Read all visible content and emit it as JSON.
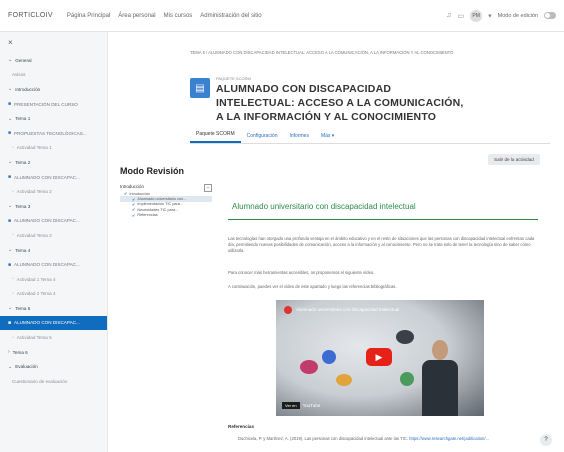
{
  "navbar": {
    "brand": "FORTICLOIV",
    "links": [
      "Página Principal",
      "Área personal",
      "Mis cursos",
      "Administración del sitio"
    ],
    "bell_icon": "bell-icon",
    "chat_icon": "chat-icon",
    "avatar": "PM",
    "edit_mode_label": "Modo de edición"
  },
  "sidebar": {
    "close": "×",
    "items": [
      {
        "label": "General",
        "kind": "section",
        "icon": "chevron-down-icon"
      },
      {
        "label": "Avisos",
        "kind": "sub",
        "icon": ""
      },
      {
        "label": "Introducción",
        "kind": "section",
        "icon": "chevron-down-icon"
      },
      {
        "label": "PRESENTACIÓN DEL CURSO",
        "kind": "activity",
        "icon": "scorm-icon"
      },
      {
        "label": "Tema 1",
        "kind": "section",
        "icon": "chevron-down-icon"
      },
      {
        "label": "PROPUESTAS TECNOLÓGICAS...",
        "kind": "activity",
        "icon": "scorm-icon"
      },
      {
        "label": "Actividad Tema 1",
        "kind": "sub",
        "icon": "doc-icon"
      },
      {
        "label": "Tema 2",
        "kind": "section",
        "icon": "chevron-down-icon"
      },
      {
        "label": "ALUMNADO CON DISCAPAC...",
        "kind": "activity",
        "icon": "scorm-icon"
      },
      {
        "label": "Actividad Tema 2",
        "kind": "sub",
        "icon": "doc-icon"
      },
      {
        "label": "Tema 3",
        "kind": "section",
        "icon": "chevron-down-icon"
      },
      {
        "label": "ALUMNADO CON DISCAPAC...",
        "kind": "activity",
        "icon": "scorm-icon"
      },
      {
        "label": "Actividad Tema 3",
        "kind": "sub",
        "icon": "doc-icon"
      },
      {
        "label": "Tema 4",
        "kind": "section",
        "icon": "chevron-down-icon"
      },
      {
        "label": "ALUMNADO CON DISCAPAC...",
        "kind": "activity",
        "icon": "scorm-icon"
      },
      {
        "label": "Actividad 1 Tema 4",
        "kind": "sub",
        "icon": "doc-icon"
      },
      {
        "label": "Actividad 2 Tema 4",
        "kind": "sub",
        "icon": "doc-icon"
      },
      {
        "label": "Tema 5",
        "kind": "section",
        "icon": "chevron-down-icon"
      },
      {
        "label": "ALUMNADO CON DISCAPAC...",
        "kind": "active",
        "icon": "scorm-icon"
      },
      {
        "label": "Actividad Tema 5",
        "kind": "sub",
        "icon": "doc-icon"
      },
      {
        "label": "Tema 6",
        "kind": "section",
        "icon": "chevron-right-icon"
      },
      {
        "label": "Evaluación",
        "kind": "section",
        "icon": "chevron-down-icon"
      },
      {
        "label": "Cuestionario de evaluación",
        "kind": "sub",
        "icon": ""
      }
    ]
  },
  "header": {
    "breadcrumb": "TEMA 5 / ALUMNADO CON DISCAPACIDAD INTELECTUAL: ACCESO A LA COMUNICACIÓN, A LA INFORMACIÓN Y AL CONOCIMIENTO",
    "activity_tag": "PAQUETE SCORM",
    "title": "ALUMNADO CON DISCAPACIDAD INTELECTUAL: ACCESO A LA COMUNICACIÓN, A LA INFORMACIÓN Y AL CONOCIMIENTO",
    "tabs": [
      "Paquete SCORM",
      "Configuración",
      "Informes",
      "Más ▾"
    ],
    "exit_label": "Salir de la actividad"
  },
  "scorm": {
    "review_label": "Modo Revisión",
    "toc_title": "Introducción",
    "toc": [
      {
        "label": "Introducción",
        "level": 1
      },
      {
        "label": "Alumnado universitario con...",
        "level": 2,
        "selected": true
      },
      {
        "label": "Implementación TIC para...",
        "level": 2
      },
      {
        "label": "Necesidades TIC para...",
        "level": 2
      },
      {
        "label": "Referencias",
        "level": 2
      }
    ],
    "collapse_icon": "minus-square-icon",
    "heading": "Alumnado universitario con discapacidad intelectual",
    "paragraphs": [
      "Las tecnologías han otorgado una profunda ventaja en el ámbito educativo y en el resto de situaciones que las personas con discapacidad intelectual enfrentan cada día, permitiendo nuevas posibilidades de comunicación, acceso a la información y al conocimiento. Pero no se trata solo de tener la tecnología sino de saber cómo utilizarla.",
      "Para conocer más herramientas accesibles, os proponemos el siguiente vídeo.",
      "A continuación, puedes ver el vídeo de este apartado y luego las referencias bibliográficas."
    ],
    "video_title": "Alumnado universitario con discapacidad intelectual",
    "watch_on": "Ver en",
    "youtube": "YouTube",
    "references_label": "Referencias",
    "reference_text": "Duchicela, P. y Martínez, A. (2019). Las personas con discapacidad intelectual ante las TIC.",
    "reference_link": "https://www.researchgate.net/publication/..."
  },
  "help_label": "?"
}
